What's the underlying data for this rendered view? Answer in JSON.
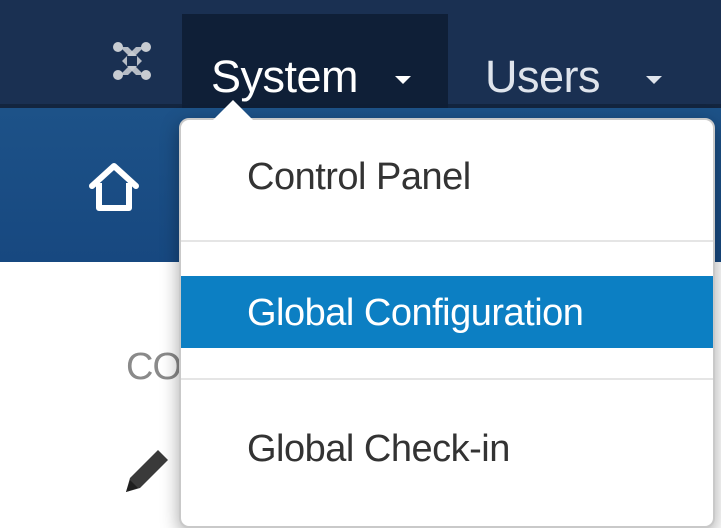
{
  "navbar": {
    "logo_icon": "joomla-logo-icon",
    "menus": [
      {
        "label": "System",
        "icon": "caret-down-icon",
        "open": true
      },
      {
        "label": "Users",
        "icon": "caret-down-icon",
        "open": false
      }
    ]
  },
  "subheader": {
    "home_icon": "home-icon"
  },
  "content": {
    "partial_text": "CO",
    "edit_icon": "pencil-icon"
  },
  "system_menu": {
    "items": [
      {
        "label": "Control Panel",
        "active": false
      },
      {
        "label": "Global Configuration",
        "active": true
      },
      {
        "label": "Global Check-in",
        "active": false
      }
    ]
  },
  "colors": {
    "navbar_bg": "#1a3052",
    "navbar_active_bg": "#0f1f37",
    "subheader_bg": "#1d5288",
    "menu_active_bg": "#0c7fc3",
    "menu_text": "#333333"
  }
}
